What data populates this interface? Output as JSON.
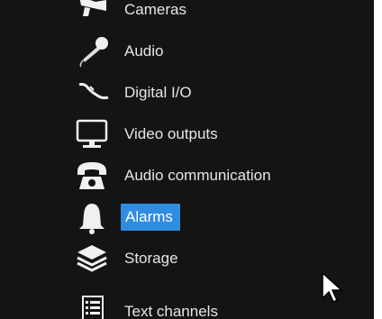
{
  "menu": {
    "items": [
      {
        "id": "cameras",
        "label": "Cameras",
        "icon": "camera-icon"
      },
      {
        "id": "audio",
        "label": "Audio",
        "icon": "microphone-icon"
      },
      {
        "id": "digital-io",
        "label": "Digital I/O",
        "icon": "wire-connector-icon"
      },
      {
        "id": "video-outputs",
        "label": "Video outputs",
        "icon": "monitor-icon"
      },
      {
        "id": "audio-communication",
        "label": "Audio communication",
        "icon": "telephone-icon"
      },
      {
        "id": "alarms",
        "label": "Alarms",
        "icon": "bell-icon",
        "selected": true
      },
      {
        "id": "storage",
        "label": "Storage",
        "icon": "layers-icon"
      },
      {
        "id": "text-channels",
        "label": "Text channels",
        "icon": "list-icon"
      }
    ]
  },
  "colors": {
    "background": "#141414",
    "text": "#e6e6e6",
    "selection": "#2f8ce0",
    "icon": "#f0f0f0"
  }
}
